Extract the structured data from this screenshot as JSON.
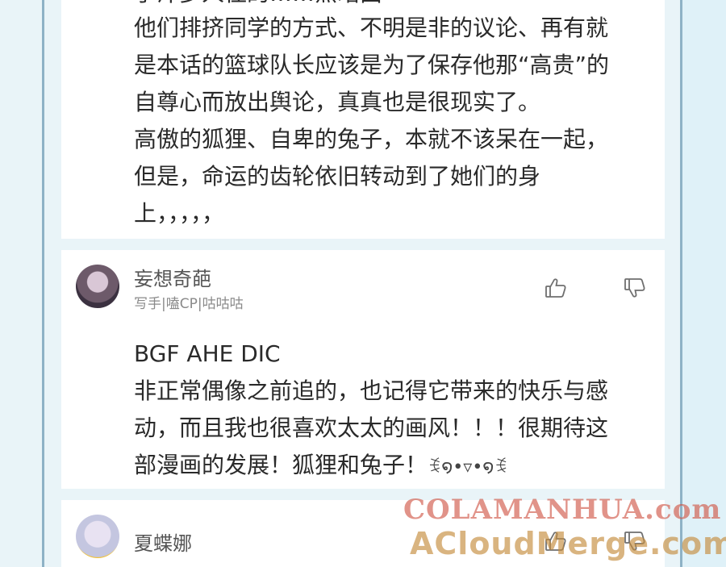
{
  "comments": [
    {
      "cut_line": "手汗多人往的……黑暗面",
      "lines": [
        "他们排挤同学的方式、不明是非的议论、再有就",
        "是本话的篮球队长应该是为了保存他那“高贵”的",
        "自尊心而放出舆论，真真也是很现实了。",
        "高傲的狐狸、自卑的兔子，本就不该呆在一起，",
        "但是，命运的齿轮依旧转动到了她们的身",
        "上，，，，，"
      ]
    },
    {
      "username": "妄想奇葩",
      "tags": "写手|嗑CP|咕咕咕",
      "lines": [
        "BGF AHE DIC",
        "非正常偶像之前追的，也记得它带来的快乐与感",
        "动，而且我也很喜欢太太的画风！！！很期待这",
        "部漫画的发展！狐狸和兔子！"
      ],
      "kaomoji": "ꉂ໑•▿•໑ꉂ"
    },
    {
      "username": "夏蝶娜"
    }
  ],
  "icons": {
    "like": "thumbs-up-icon",
    "dislike": "thumbs-down-icon"
  },
  "watermark": {
    "line1": "COLAMANHUA.com",
    "line2": "ACloudMerge.com"
  }
}
